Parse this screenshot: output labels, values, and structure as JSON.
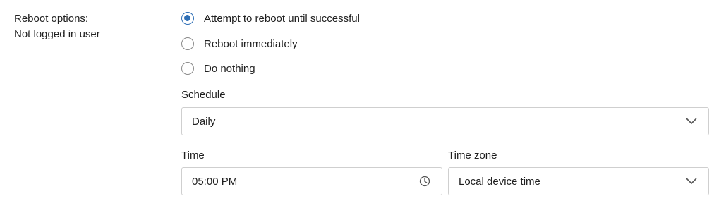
{
  "reboot": {
    "label_line1": "Reboot options:",
    "label_line2": "Not logged in user",
    "options": [
      {
        "label": "Attempt to reboot until successful",
        "selected": true
      },
      {
        "label": "Reboot immediately",
        "selected": false
      },
      {
        "label": "Do nothing",
        "selected": false
      }
    ]
  },
  "schedule": {
    "label": "Schedule",
    "value": "Daily",
    "icon": "chevron-down-icon"
  },
  "time": {
    "label": "Time",
    "value": "05:00 PM",
    "icon": "clock-icon"
  },
  "timezone": {
    "label": "Time zone",
    "value": "Local device time",
    "icon": "chevron-down-icon"
  },
  "colors": {
    "accent": "#2f6fb6",
    "border": "#cfcfcf",
    "text": "#1f1f1f"
  }
}
